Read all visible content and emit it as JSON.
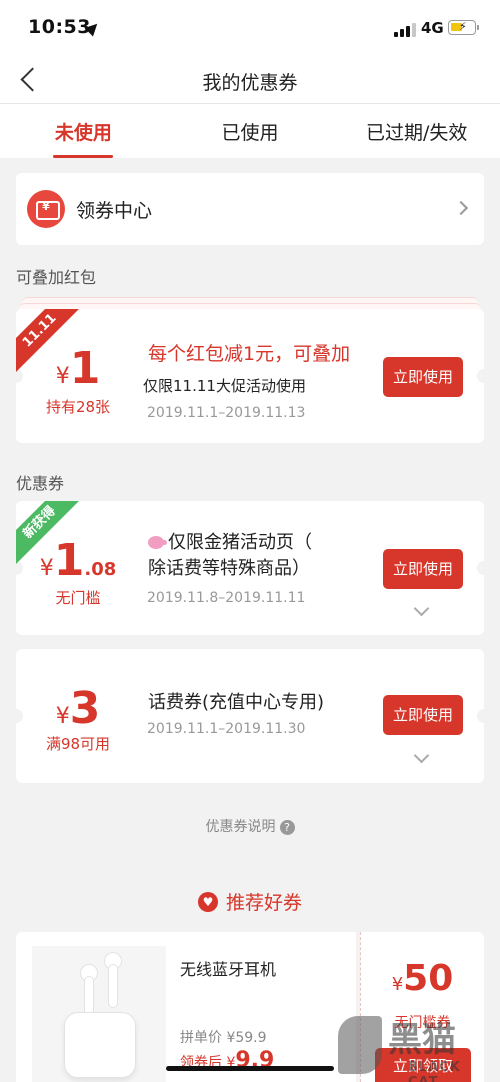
{
  "status": {
    "time": "10:53",
    "network": "4G"
  },
  "nav": {
    "title": "我的优惠券"
  },
  "tabs": [
    {
      "label": "未使用",
      "active": true
    },
    {
      "label": "已使用",
      "active": false
    },
    {
      "label": "已过期/失效",
      "active": false
    }
  ],
  "coupon_center": {
    "icon_glyph": "¥",
    "label": "领券中心"
  },
  "sections": {
    "stackable": "可叠加红包",
    "coupons": "优惠券"
  },
  "coupons": [
    {
      "ribbon": "11.11",
      "yen": "¥",
      "amount_int": "1",
      "amount_dec": "",
      "sub": "持有28张",
      "title": "每个红包减1元，可叠加",
      "desc": "仅限11.11大促活动使用",
      "date": "2019.11.1–2019.11.13",
      "button": "立即使用"
    },
    {
      "ribbon": "新获得",
      "yen": "¥",
      "amount_int": "1",
      "amount_dec": ".08",
      "sub": "无门槛",
      "title_line1": "仅限金猪活动页（",
      "title_line2": "除话费等特殊商品）",
      "date": "2019.11.8–2019.11.11",
      "button": "立即使用"
    },
    {
      "yen": "¥",
      "amount_int": "3",
      "amount_dec": "",
      "sub": "满98可用",
      "title": "话费券(充值中心专用)",
      "date": "2019.11.1–2019.11.30",
      "button": "立即使用"
    }
  ],
  "explain": {
    "label": "优惠券说明",
    "icon": "?"
  },
  "recommend": {
    "title": "推荐好券"
  },
  "product": {
    "name": "无线蓝牙耳机",
    "price_label": "拼单价 ¥59.9",
    "after_label": "领券后 ¥",
    "after_value": "9.9"
  },
  "voucher": {
    "yen": "¥",
    "amount": "50",
    "condition": "无门槛券",
    "button": "立即领取"
  },
  "watermark": {
    "main": "黑猫",
    "sub": "BLACK CAT"
  },
  "colors": {
    "accent": "#d7362b",
    "green": "#4cb963",
    "background": "#f2f2f2"
  }
}
